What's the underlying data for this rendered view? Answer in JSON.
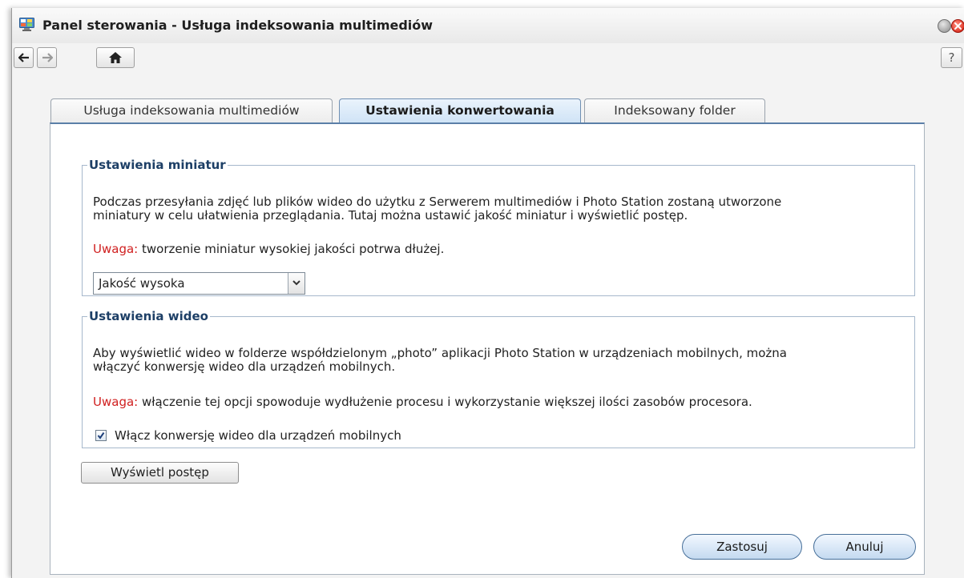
{
  "window": {
    "title": "Panel sterowania - Usługa indeksowania multimediów",
    "help_label": "?"
  },
  "tabs": [
    {
      "label": "Usługa indeksowania multimediów",
      "active": false
    },
    {
      "label": "Ustawienia konwertowania",
      "active": true
    },
    {
      "label": "Indeksowany folder",
      "active": false
    }
  ],
  "thumbnails": {
    "legend": "Ustawienia miniatur",
    "description_line1": "Podczas przesyłania zdjęć lub plików wideo do użytku z Serwerem multimediów i Photo Station zostaną utworzone",
    "description_line2": "miniatury w celu ułatwienia przeglądania. Tutaj można ustawić jakość miniatur i wyświetlić postęp.",
    "warning_label": "Uwaga:",
    "warning_text": " tworzenie miniatur wysokiej jakości potrwa dłużej.",
    "quality_selected": "Jakość wysoka"
  },
  "video": {
    "legend": "Ustawienia wideo",
    "description_line1": "Aby wyświetlić wideo w folderze współdzielonym „photo” aplikacji Photo Station w urządzeniach mobilnych, można",
    "description_line2": "włączyć konwersję wideo dla urządzeń mobilnych.",
    "warning_label": "Uwaga:",
    "warning_text": " włączenie tej opcji spowoduje wydłużenie procesu i wykorzystanie większej ilości zasobów procesora.",
    "checkbox_label": "Włącz konwersję wideo dla urządzeń mobilnych",
    "checkbox_checked": true
  },
  "buttons": {
    "show_progress": "Wyświetl postęp",
    "apply": "Zastosuj",
    "cancel": "Anuluj"
  },
  "icons": [
    "control-panel-icon",
    "minimize-icon",
    "close-icon",
    "back-arrow-icon",
    "forward-arrow-icon",
    "home-icon",
    "chevron-down-icon",
    "checkmark-icon"
  ],
  "colors": {
    "warning": "#d02020",
    "legend": "#1d3f66",
    "active_tab_accent": "#2c6fb0"
  }
}
